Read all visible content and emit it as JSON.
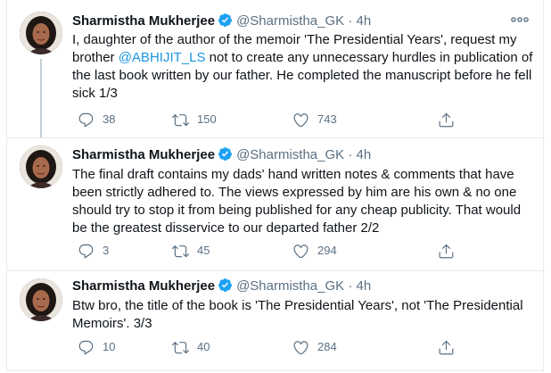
{
  "tweets": [
    {
      "author_name": "Sharmistha Mukherjee",
      "handle": "@Sharmistha_GK",
      "separator": "·",
      "time": "4h",
      "text_before_mention": "I, daughter of the author of the memoir 'The Presidential Years', request my brother ",
      "mention": "@ABHIJIT_LS",
      "text_after_mention": " not to create any unnecessary hurdles in publication of the last book written by our father. He completed the manuscript before he fell sick 1/3",
      "replies": "38",
      "retweets": "150",
      "likes": "743"
    },
    {
      "author_name": "Sharmistha Mukherjee",
      "handle": "@Sharmistha_GK",
      "separator": "·",
      "time": "4h",
      "text": "The final draft contains my dads' hand written notes & comments that have been strictly adhered to. The views expressed by him are his own & no one should try to stop it from being published for any cheap publicity. That would be the greatest disservice to our departed father 2/2",
      "replies": "3",
      "retweets": "45",
      "likes": "294"
    },
    {
      "author_name": "Sharmistha Mukherjee",
      "handle": "@Sharmistha_GK",
      "separator": "·",
      "time": "4h",
      "text": "Btw bro, the title of the book is 'The Presidential Years', not 'The Presidential Memoirs'. 3/3",
      "replies": "10",
      "retweets": "40",
      "likes": "284"
    }
  ],
  "more_glyph": "○○○",
  "colors": {
    "verified": "#1da1f2",
    "secondary_text": "#5b7083",
    "mention": "#1b95e0",
    "divider": "#e6ecf0",
    "thread_line": "#c4cfd6"
  },
  "icons": [
    "verified-badge-icon",
    "more-options-icon",
    "reply-icon",
    "retweet-icon",
    "like-icon",
    "share-icon"
  ]
}
